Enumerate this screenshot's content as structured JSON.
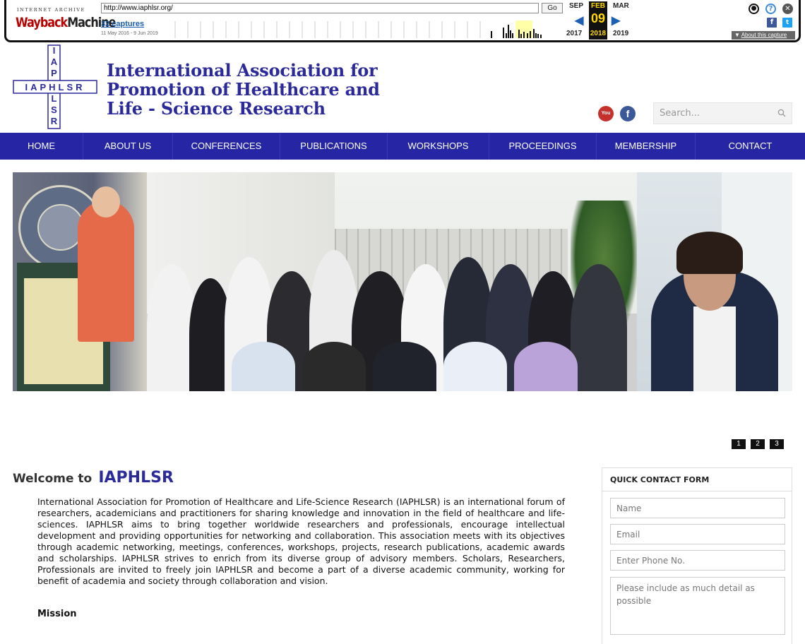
{
  "wayback": {
    "archive_label": "INTERNET ARCHIVE",
    "logo_text_1": "Wayback",
    "logo_text_2": "Machine",
    "url": "http://www.iaphlsr.org/",
    "go_label": "Go",
    "captures": "32 captures",
    "range": "11 May 2016 - 9 Jun 2019",
    "prev_month": "SEP",
    "cur_month": "FEB",
    "next_month": "MAR",
    "day": "09",
    "prev_year": "2017",
    "cur_year": "2018",
    "next_year": "2019",
    "about": "About this capture"
  },
  "logo": {
    "horizontal": "IAPHLSR",
    "vertical": [
      "I",
      "A",
      "P",
      "H",
      "L",
      "S",
      "R"
    ]
  },
  "site": {
    "title_lines": [
      "International Association for",
      "Promotion of Healthcare and",
      "Life - Science Research"
    ]
  },
  "search": {
    "placeholder": "Search..."
  },
  "nav": [
    "HOME",
    "ABOUT US",
    "CONFERENCES",
    "PUBLICATIONS",
    "WORKSHOPS",
    "PROCEEDINGS",
    "MEMBERSHIP",
    "CONTACT"
  ],
  "slider": {
    "pages": [
      "1",
      "2",
      "3"
    ]
  },
  "welcome": {
    "prefix": "Welcome to",
    "name": "IAPHLSR",
    "body": "International Association for Promotion of Healthcare and Life-Science Research (IAPHLSR) is an international forum of researchers, academicians and practitioners for sharing knowledge and innovation in the field of healthcare and life-sciences. IAPHLSR aims to bring together worldwide researchers and professionals, encourage intellectual development and providing opportunities for networking and collaboration. This association meets with its objectives through academic networking, meetings, conferences, workshops, projects, research publications, academic awards and scholarships. IAPHLSR strives to enrich from its diverse group of advisory members. Scholars, Researchers, Professionals are invited to freely join IAPHLSR and become a part of a diverse academic community, working for benefit of academia and society through collaboration and vision.",
    "mission_heading": "Mission"
  },
  "contact_form": {
    "title": "QUICK CONTACT FORM",
    "name_placeholder": "Name",
    "email_placeholder": "Email",
    "phone_placeholder": "Enter Phone No.",
    "message_placeholder": "Please include as much detail as possible"
  },
  "colors": {
    "brand": "#2626a4",
    "title": "#2a2a9a",
    "youtube": "#c4302b",
    "facebook": "#3b5998"
  },
  "icons": [
    "account-icon",
    "help-icon",
    "close-icon",
    "facebook-icon",
    "twitter-icon",
    "youtube-icon",
    "search-icon"
  ]
}
